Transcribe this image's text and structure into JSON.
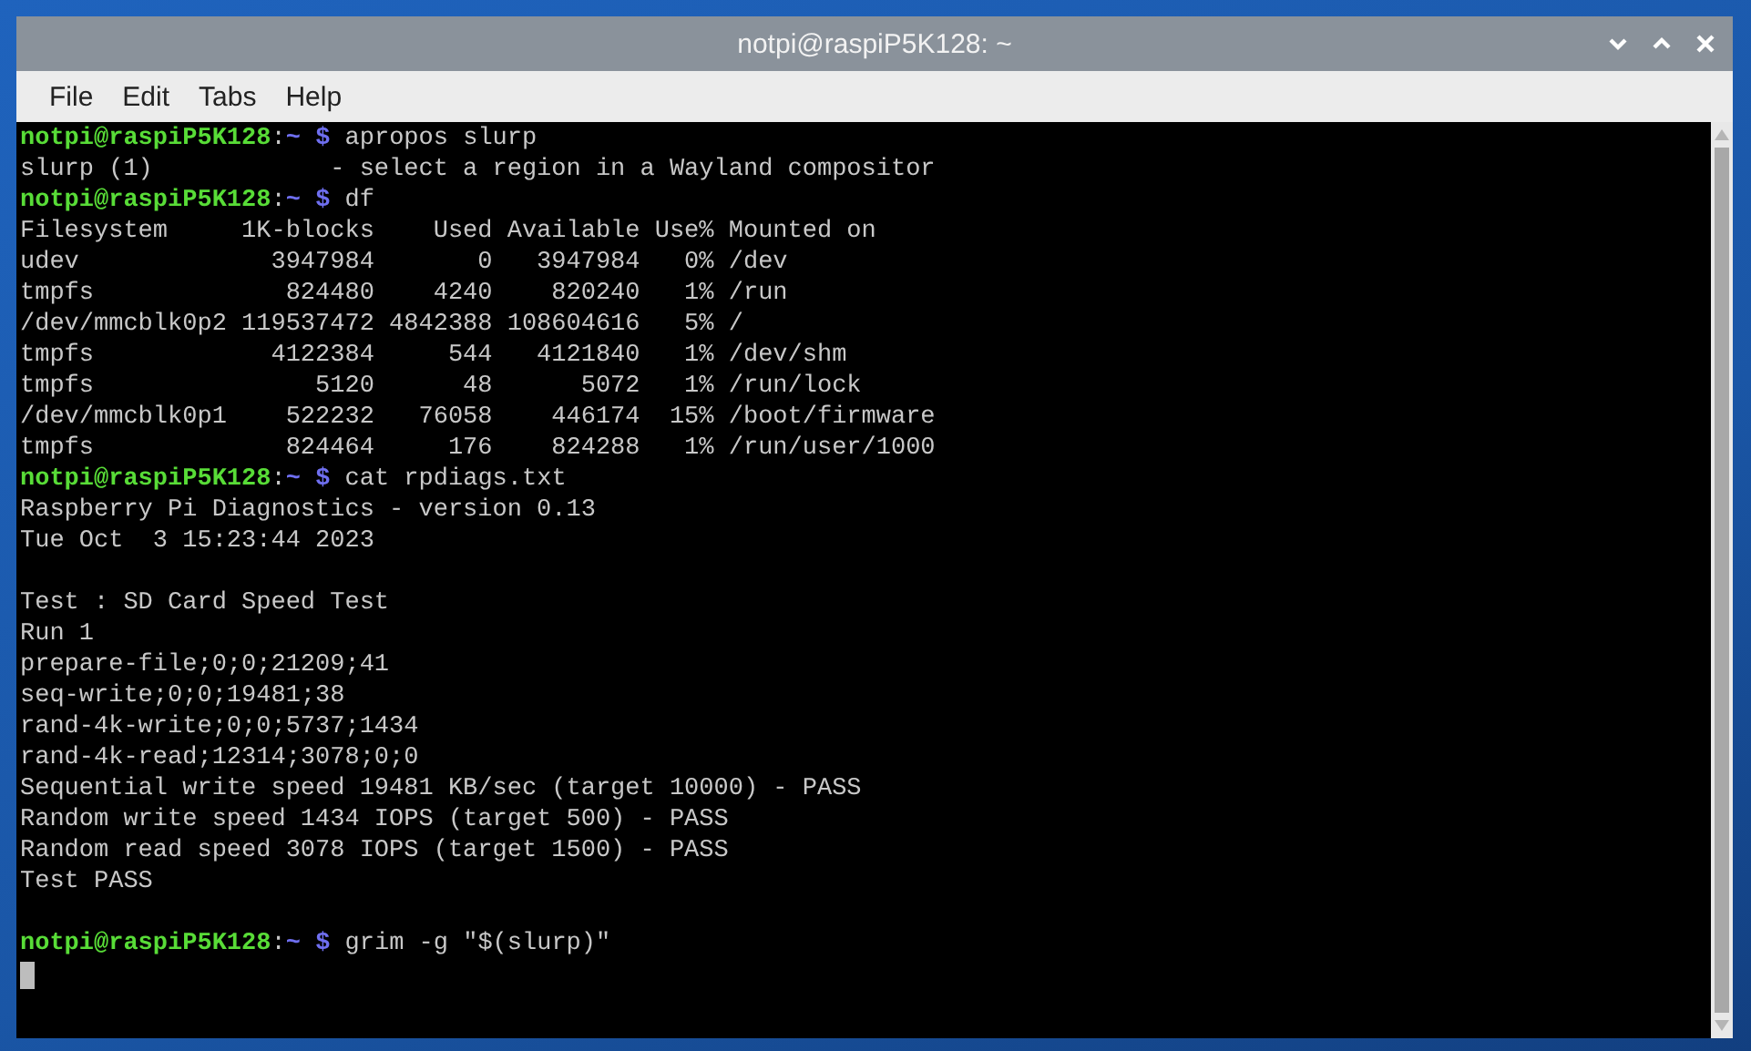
{
  "window": {
    "title": "notpi@raspiP5K128: ~"
  },
  "menu": [
    "File",
    "Edit",
    "Tabs",
    "Help"
  ],
  "terminal": {
    "lines": [
      {
        "kind": "prompt",
        "user_host": "notpi@raspiP5K128",
        "separator": ":",
        "path": "~",
        "symbol": "$",
        "command": "apropos slurp"
      },
      {
        "kind": "output",
        "text": "slurp (1)            - select a region in a Wayland compositor"
      },
      {
        "kind": "prompt",
        "user_host": "notpi@raspiP5K128",
        "separator": ":",
        "path": "~",
        "symbol": "$",
        "command": "df"
      },
      {
        "kind": "output",
        "text": "Filesystem     1K-blocks    Used Available Use% Mounted on"
      },
      {
        "kind": "output",
        "text": "udev             3947984       0   3947984   0% /dev"
      },
      {
        "kind": "output",
        "text": "tmpfs             824480    4240    820240   1% /run"
      },
      {
        "kind": "output",
        "text": "/dev/mmcblk0p2 119537472 4842388 108604616   5% /"
      },
      {
        "kind": "output",
        "text": "tmpfs            4122384     544   4121840   1% /dev/shm"
      },
      {
        "kind": "output",
        "text": "tmpfs               5120      48      5072   1% /run/lock"
      },
      {
        "kind": "output",
        "text": "/dev/mmcblk0p1    522232   76058    446174  15% /boot/firmware"
      },
      {
        "kind": "output",
        "text": "tmpfs             824464     176    824288   1% /run/user/1000"
      },
      {
        "kind": "prompt",
        "user_host": "notpi@raspiP5K128",
        "separator": ":",
        "path": "~",
        "symbol": "$",
        "command": "cat rpdiags.txt"
      },
      {
        "kind": "output",
        "text": "Raspberry Pi Diagnostics - version 0.13"
      },
      {
        "kind": "output",
        "text": "Tue Oct  3 15:23:44 2023"
      },
      {
        "kind": "blank"
      },
      {
        "kind": "output",
        "text": "Test : SD Card Speed Test"
      },
      {
        "kind": "output",
        "text": "Run 1"
      },
      {
        "kind": "output",
        "text": "prepare-file;0;0;21209;41"
      },
      {
        "kind": "output",
        "text": "seq-write;0;0;19481;38"
      },
      {
        "kind": "output",
        "text": "rand-4k-write;0;0;5737;1434"
      },
      {
        "kind": "output",
        "text": "rand-4k-read;12314;3078;0;0"
      },
      {
        "kind": "output",
        "text": "Sequential write speed 19481 KB/sec (target 10000) - PASS"
      },
      {
        "kind": "output",
        "text": "Random write speed 1434 IOPS (target 500) - PASS"
      },
      {
        "kind": "output",
        "text": "Random read speed 3078 IOPS (target 1500) - PASS"
      },
      {
        "kind": "output",
        "text": "Test PASS"
      },
      {
        "kind": "blank"
      },
      {
        "kind": "prompt",
        "user_host": "notpi@raspiP5K128",
        "separator": ":",
        "path": "~",
        "symbol": "$",
        "command": "grim -g \"$(slurp)\""
      },
      {
        "kind": "cursor"
      }
    ]
  }
}
